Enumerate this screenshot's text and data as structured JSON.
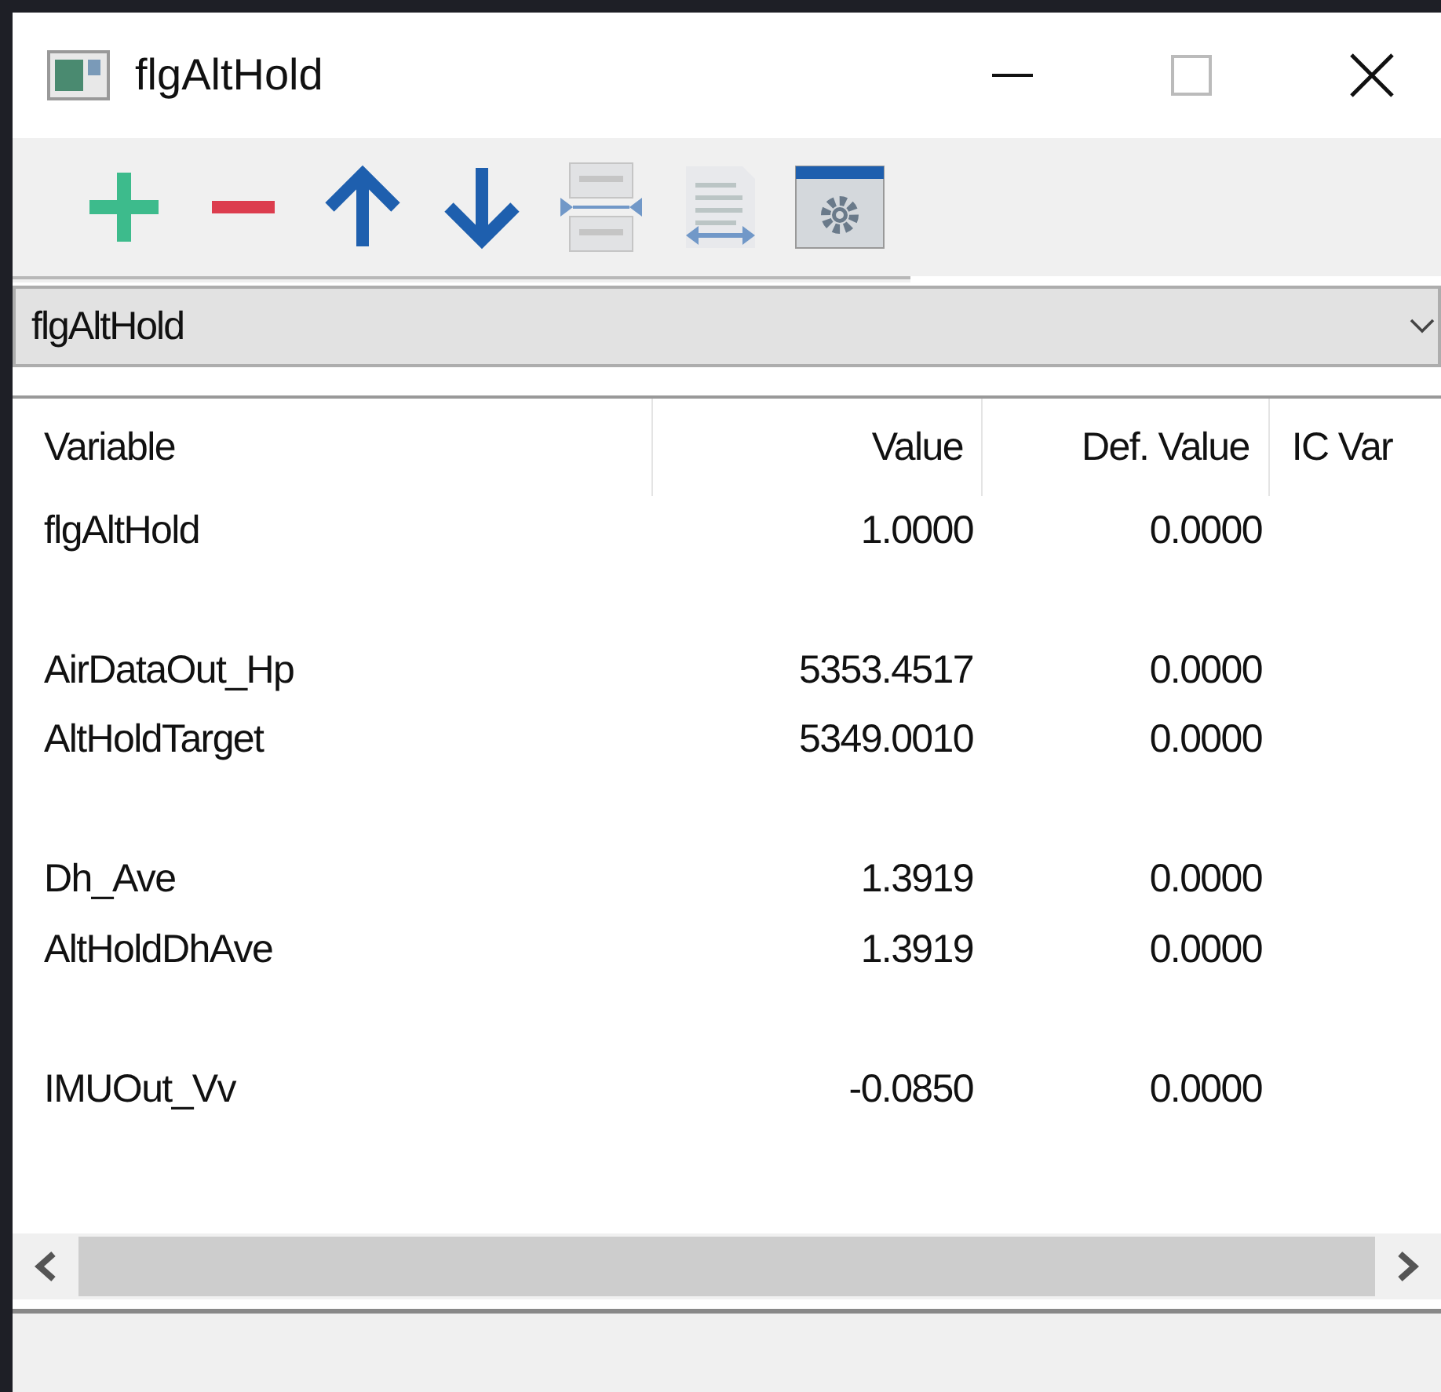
{
  "window": {
    "title": "flgAltHold"
  },
  "toolbar": [
    {
      "kind": "add",
      "disabled": false
    },
    {
      "kind": "remove",
      "disabled": false
    },
    {
      "kind": "up",
      "disabled": false
    },
    {
      "kind": "down",
      "disabled": false
    },
    {
      "kind": "insert",
      "disabled": true
    },
    {
      "kind": "wrap",
      "disabled": true
    },
    {
      "kind": "settings",
      "disabled": false
    }
  ],
  "dropdown": {
    "value": "flgAltHold"
  },
  "table": {
    "columns": [
      "Variable",
      "Value",
      "Def. Value",
      "IC Var"
    ],
    "rows": [
      {
        "kind": "variable",
        "cells": [
          "flgAltHold",
          "1.0000",
          "0.0000"
        ]
      },
      {
        "kind": "spacer"
      },
      {
        "kind": "variable",
        "cells": [
          "AirDataOut_Hp",
          "5353.4517",
          "0.0000"
        ]
      },
      {
        "kind": "variable",
        "cells": [
          "AltHoldTarget",
          "5349.0010",
          "0.0000"
        ]
      },
      {
        "kind": "spacer"
      },
      {
        "kind": "variable",
        "cells": [
          "Dh_Ave",
          "1.3919",
          "0.0000"
        ]
      },
      {
        "kind": "variable",
        "cells": [
          "AltHoldDhAve",
          "1.3919",
          "0.0000"
        ]
      },
      {
        "kind": "spacer"
      },
      {
        "kind": "variable",
        "cells": [
          "IMUOut_Vv",
          "-0.0850",
          "0.0000"
        ]
      }
    ]
  }
}
